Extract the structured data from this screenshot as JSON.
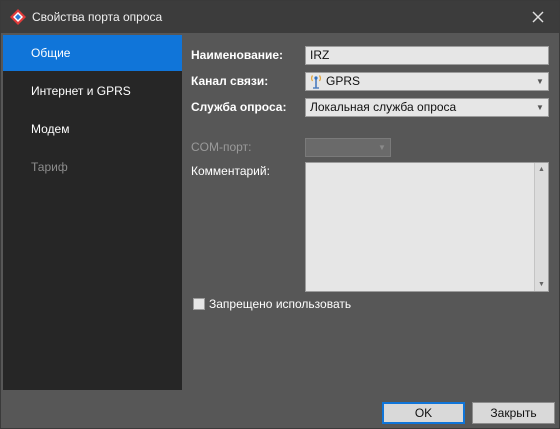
{
  "window": {
    "title": "Свойства порта опроса"
  },
  "sidebar": {
    "items": [
      {
        "label": "Общие",
        "state": "active"
      },
      {
        "label": "Интернет и GPRS",
        "state": "normal"
      },
      {
        "label": "Модем",
        "state": "normal"
      },
      {
        "label": "Тариф",
        "state": "disabled"
      }
    ]
  },
  "form": {
    "name_label": "Наименование:",
    "name_value": "IRZ",
    "channel_label": "Канал связи:",
    "channel_value": "GPRS",
    "channel_icon": "antenna-icon",
    "service_label": "Служба опроса:",
    "service_value": "Локальная служба опроса",
    "com_label": "COM-порт:",
    "comment_label": "Комментарий:",
    "disabled_label": "Запрещено использовать",
    "disabled_checked": false
  },
  "buttons": {
    "ok": "OK",
    "close": "Закрыть"
  },
  "colors": {
    "accent": "#1075d9",
    "sidebar_bg": "#262626",
    "content_bg": "#575757"
  }
}
